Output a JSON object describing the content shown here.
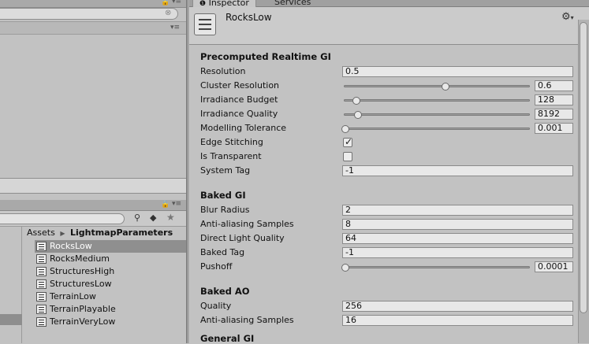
{
  "tabs": {
    "inspector": "Inspector",
    "services": "Services"
  },
  "object": {
    "name": "RocksLow"
  },
  "project": {
    "breadcrumb": [
      "Assets",
      "LightmapParameters"
    ],
    "items": [
      "RocksLow",
      "RocksMedium",
      "StructuresHigh",
      "StructuresLow",
      "TerrainLow",
      "TerrainPlayable",
      "TerrainVeryLow"
    ],
    "selected_item": "RocksLow"
  },
  "sections": {
    "realtime": {
      "title": "Precomputed Realtime GI",
      "resolution": {
        "label": "Resolution",
        "value": "0.5"
      },
      "cluster_resolution": {
        "label": "Cluster Resolution",
        "value": "0.6",
        "fraction": 0.55
      },
      "irradiance_budget": {
        "label": "Irradiance Budget",
        "value": "128",
        "fraction": 0.06
      },
      "irradiance_quality": {
        "label": "Irradiance Quality",
        "value": "8192",
        "fraction": 0.07
      },
      "modelling_tolerance": {
        "label": "Modelling Tolerance",
        "value": "0.001",
        "fraction": 0.0
      },
      "edge_stitching": {
        "label": "Edge Stitching",
        "checked": true
      },
      "is_transparent": {
        "label": "Is Transparent",
        "checked": false
      },
      "system_tag": {
        "label": "System Tag",
        "value": "-1"
      }
    },
    "baked": {
      "title": "Baked GI",
      "blur_radius": {
        "label": "Blur Radius",
        "value": "2"
      },
      "anti_aliasing": {
        "label": "Anti-aliasing Samples",
        "value": "8"
      },
      "direct_light_quality": {
        "label": "Direct Light Quality",
        "value": "64"
      },
      "baked_tag": {
        "label": "Baked Tag",
        "value": "-1"
      },
      "pushoff": {
        "label": "Pushoff",
        "value": "0.0001",
        "fraction": 0.0
      }
    },
    "ao": {
      "title": "Baked AO",
      "quality": {
        "label": "Quality",
        "value": "256"
      },
      "anti_aliasing": {
        "label": "Anti-aliasing Samples",
        "value": "16"
      }
    },
    "general": {
      "title": "General GI"
    }
  }
}
